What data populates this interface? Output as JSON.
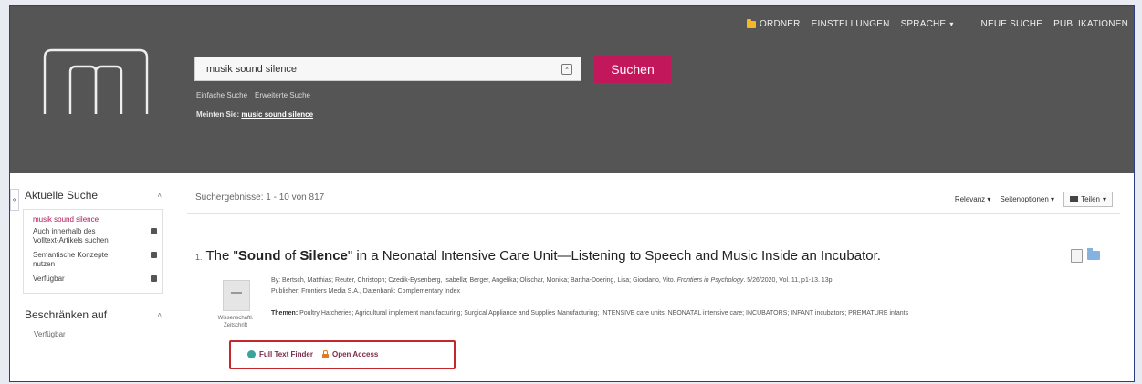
{
  "topnav": {
    "folder": "ORDNER",
    "settings": "EINSTELLUNGEN",
    "language": "SPRACHE",
    "new_search": "NEUE SUCHE",
    "publications": "PUBLIKATIONEN"
  },
  "search": {
    "value": "musik sound silence",
    "button": "Suchen",
    "simple": "Einfache Suche",
    "advanced": "Erweiterte Suche",
    "did_you_mean_label": "Meinten Sie:",
    "did_you_mean_term": "music sound silence"
  },
  "sidebar": {
    "current_search_title": "Aktuelle Suche",
    "current_term": "musik sound silence",
    "facets": [
      "Auch innerhalb des Volltext-Artikels suchen",
      "Semantische Konzepte nutzen",
      "Verfügbar"
    ],
    "limit_title": "Beschränken auf",
    "limit_sub": "Verfügbar"
  },
  "results": {
    "count": "Suchergebnisse: 1 - 10 von 817",
    "sort": "Relevanz",
    "page_options": "Seitenoptionen",
    "share": "Teilen",
    "item": {
      "number": "1.",
      "title_pre": "The \"",
      "title_b1": "Sound",
      "title_mid": " of ",
      "title_b2": "Silence",
      "title_post": "\" in a Neonatal Intensive Care Unit—Listening to Speech and Music Inside an Incubator.",
      "thumb_label": "Wissenschaftl. Zeitschrift",
      "authors_prefix": "By: Bertsch, Matthias; Reuter, Christoph; Czedik-Eysenberg, Isabella; Berger, Angelika; Olischar, Monika; Bartha-Doering, Lisa; Giordano, Vito.",
      "journal": "Frontiers in Psychology",
      "citation": ". 5/26/2020, Vol. 11, p1-13. 13p.",
      "publisher": "Publisher: Frontiers Media S.A., Datenbank: Complementary Index",
      "subjects_label": "Themen:",
      "subjects": "Poultry Hatcheries; Agricultural implement manufacturing; Surgical Appliance and Supplies Manufacturing; INTENSIVE care units; NEONATAL intensive care; INCUBATORS; INFANT incubators; PREMATURE infants",
      "full_text_finder": "Full Text Finder",
      "open_access": "Open Access"
    }
  }
}
